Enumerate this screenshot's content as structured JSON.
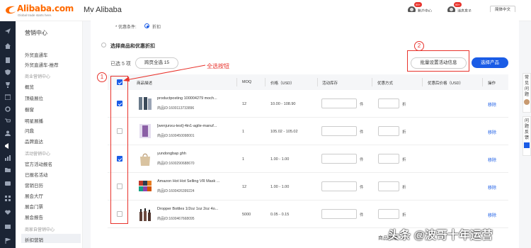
{
  "header": {
    "logo_text": "Alibaba.com",
    "logo_tagline": "Global trade starts here.",
    "title": "My Alibaba",
    "user_badge": "99+",
    "user_label": "账户中心",
    "msg_badge": "99+",
    "msg_label": "消息盒子",
    "language": "简体中文"
  },
  "sidebar": {
    "heading": "营销中心",
    "items_top": [
      "外贸直通车",
      "外贸直通车-推荐"
    ],
    "section_marketing": "商业营销中心",
    "items_marketing": [
      "概览",
      "顶级展位",
      "橱窗",
      "明星展播",
      "问鼎",
      "品牌直达"
    ],
    "section_activity": "活动营销中心",
    "items_activity": [
      "官方活动报名",
      "已报名活动",
      "营销日历",
      "展会大厅",
      "展会门票",
      "展会报告"
    ],
    "section_merchant": "商家自营销中心",
    "active_item": "折扣营销"
  },
  "form": {
    "discount_condition_label": "* 优惠条件:",
    "discount_option": "折扣",
    "select_title": "选择商品和优惠折扣",
    "selected_count": "已选 5 项",
    "cross_page_select": "跨页全选 15",
    "batch_set_button": "批量设置活动信息",
    "select_product_button": "选择产品"
  },
  "annotations": {
    "marker_1": "1",
    "marker_2": "2",
    "select_all_note": "全选按钮"
  },
  "table": {
    "columns": [
      "商品描述",
      "MOQ",
      "价格（USD）",
      "活动库存",
      "优惠方式",
      "优惠后价格（USD）",
      "操作"
    ],
    "unit_piece": "件",
    "unit_discount": "折",
    "remove_label": "移除",
    "rows": [
      {
        "checked": true,
        "name": "productposting 100004279 moch...",
        "id": "商品ID:1600113733896",
        "moq": "12",
        "price": "10.00 - 108.90"
      },
      {
        "checked": false,
        "name": "[wenjunxu-test]-4in1-agile-manuf...",
        "id": "商品ID:1600450098001",
        "moq": "1",
        "price": "105.02 - 105.02"
      },
      {
        "checked": true,
        "name": "yundongbap ghh",
        "id": "商品ID:1600290688670",
        "moq": "1",
        "price": "1.00 - 1.00"
      },
      {
        "checked": false,
        "name": "Amazon Hot Hot Selling VR Mask ...",
        "id": "商品ID:1600426399224",
        "moq": "12",
        "price": "1.00 - 1.00"
      },
      {
        "checked": false,
        "name": "Dropper Bottles 1/2oz 1oz 2oz 4o...",
        "id": "商品ID:1600467668095",
        "moq": "5000",
        "price": "0.05 - 0.15"
      }
    ]
  },
  "float_panel": {
    "faq": "常见问题",
    "feedback": "问题反馈"
  },
  "footer": {
    "partial_text": "商品数量",
    "watermark": "头条 @波哥十年运营"
  },
  "colors": {
    "primary": "#1a5ce6",
    "annotation": "#e8332c",
    "brand": "#ff6a00",
    "rail_bg": "#1b2434"
  }
}
